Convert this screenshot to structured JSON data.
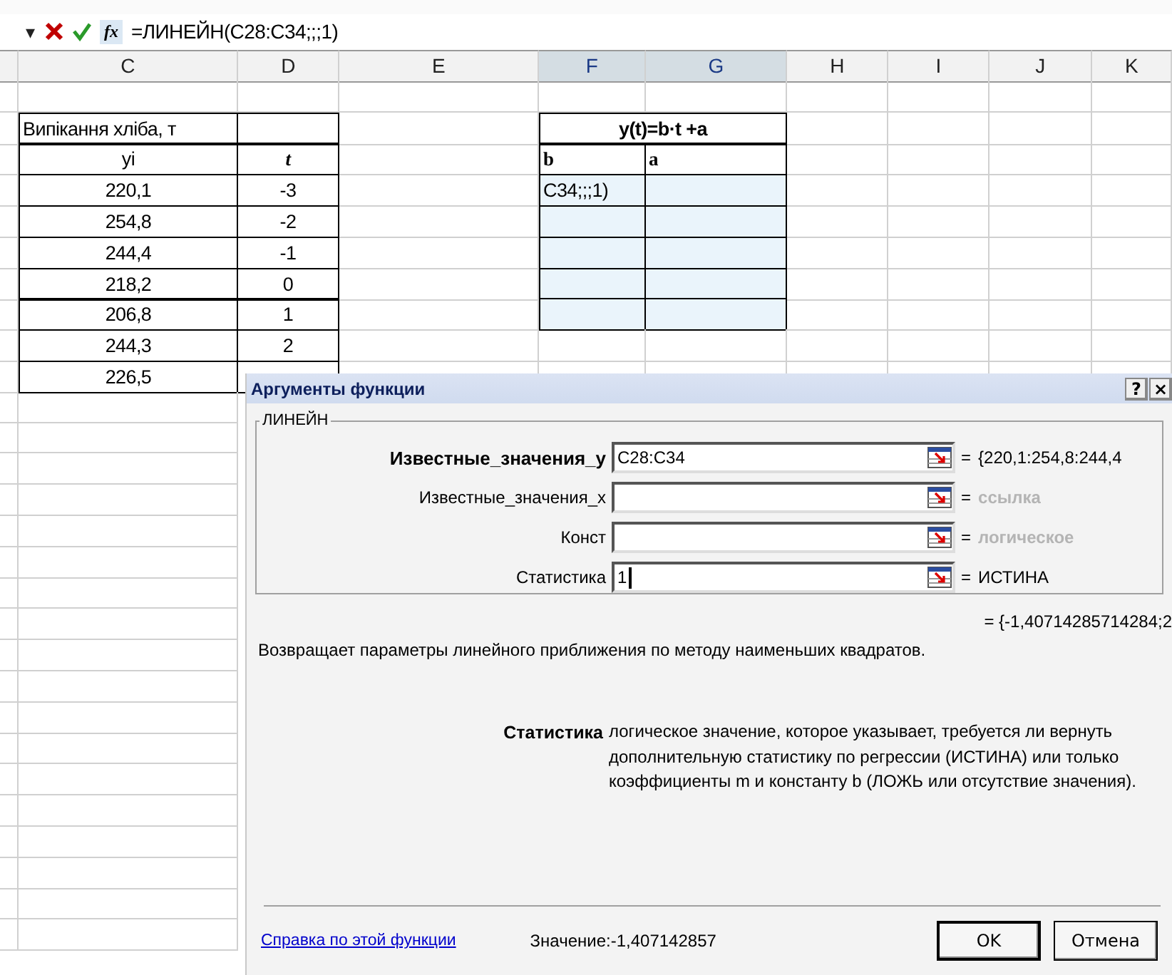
{
  "formula_bar": {
    "dropdown": "▾",
    "fx": "fx",
    "formula": "=ЛИНЕЙН(C28:C34;;;1)"
  },
  "columns": [
    {
      "label": "C",
      "selected": false
    },
    {
      "label": "D",
      "selected": false
    },
    {
      "label": "E",
      "selected": false
    },
    {
      "label": "F",
      "selected": true
    },
    {
      "label": "G",
      "selected": true
    },
    {
      "label": "H",
      "selected": false
    },
    {
      "label": "I",
      "selected": false
    },
    {
      "label": "J",
      "selected": false
    },
    {
      "label": "K",
      "selected": false
    }
  ],
  "rows": [
    {
      "in_range": false
    },
    {
      "in_range": false,
      "c": "Випікання хліба, т",
      "fg": "y(t)=b·t +a"
    },
    {
      "in_range": false,
      "c": "yi",
      "d": "t",
      "f": "b",
      "g": "a"
    },
    {
      "in_range": true,
      "c": "220,1",
      "d": "-3",
      "f": "C34;;;1)"
    },
    {
      "in_range": true,
      "c": "254,8",
      "d": "-2"
    },
    {
      "in_range": true,
      "c": "244,4",
      "d": "-1"
    },
    {
      "in_range": true,
      "c": "218,2",
      "d": "0"
    },
    {
      "in_range": true,
      "c": "206,8",
      "d": "1"
    },
    {
      "in_range": false,
      "c": "244,3",
      "d": "2"
    },
    {
      "in_range": false,
      "c": "226,5"
    }
  ],
  "dialog": {
    "title": "Аргументы функции",
    "help_button": "?",
    "close_button": "×",
    "function_name": "ЛИНЕЙН",
    "arguments": [
      {
        "label": "Известные_значения_y",
        "required": true,
        "value": "C28:C34",
        "focused": false,
        "equals": "=",
        "result": "{220,1:254,8:244,4",
        "kind": "value"
      },
      {
        "label": "Известные_значения_x",
        "required": false,
        "equals": "=",
        "result": "ссылка",
        "kind": "hint",
        "focused": false
      },
      {
        "label": "Конст",
        "required": false,
        "equals": "=",
        "result": "логическое",
        "kind": "hint",
        "focused": false
      },
      {
        "label": "Статистика",
        "required": false,
        "value": "1",
        "focused": true,
        "equals": "=",
        "result": "ИСТИНА",
        "kind": "value"
      }
    ],
    "formula_result": "= {-1,40714285714284;2",
    "description": "Возвращает параметры линейного приближения по методу наименьших квадратов.",
    "arg_name": "Статистика",
    "arg_help": "логическое значение, которое указывает, требуется ли вернуть дополнительную статистику по регрессии (ИСТИНА) или только коэффициенты m и константу b (ЛОЖЬ или отсутствие значения).",
    "help_link": "Справка по этой функции",
    "value_label": "Значение:",
    "value": "-1,407142857",
    "buttons": [
      "OK",
      "Отмена"
    ]
  }
}
